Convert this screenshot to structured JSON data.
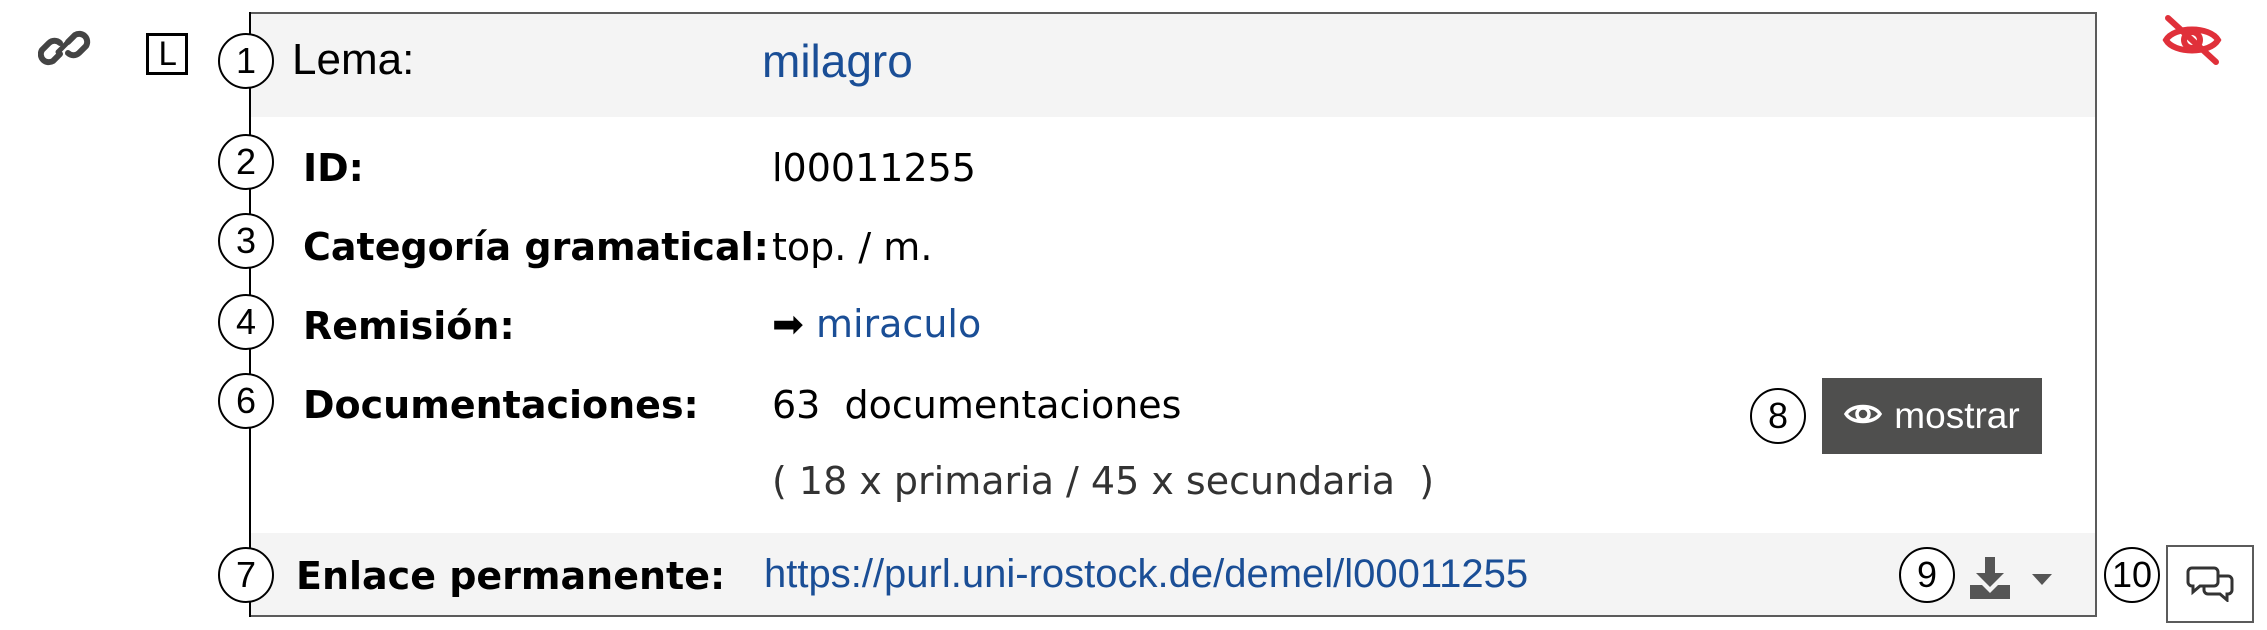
{
  "entry": {
    "type_badge": "L",
    "rows": [
      {
        "marker": "1",
        "label": "Lema:",
        "value": "milagro"
      },
      {
        "marker": "2",
        "label": "ID:",
        "value": "l00011255"
      },
      {
        "marker": "3",
        "label": "Categoría gramatical:",
        "value": "top. / m."
      },
      {
        "marker": "4",
        "label": "Remisión:",
        "arrow": "➡",
        "value": "miraculo"
      },
      {
        "marker": "6",
        "label": "Documentaciones:",
        "value": "63  documentaciones",
        "detail": "( 18 x primaria / 45 x secundaria  )"
      },
      {
        "marker": "7",
        "label": "Enlace permanente:",
        "value": "https://purl.uni-rostock.de/demel/l00011255"
      }
    ],
    "show_button": {
      "marker": "8",
      "label": "mostrar",
      "icon": "eye-icon"
    },
    "download": {
      "marker": "9",
      "icon": "download-icon",
      "caret": "chevron-down-icon"
    },
    "comment": {
      "marker": "10",
      "icon": "comments-icon"
    },
    "link_icon": "link-icon",
    "hidden_icon": "eye-slash-icon"
  },
  "colors": {
    "link": "#1a4e96",
    "band": "#f4f4f4",
    "button_bg": "#4f4f4e",
    "hidden_icon": "#e0303a",
    "border": "#5b5b5b"
  }
}
